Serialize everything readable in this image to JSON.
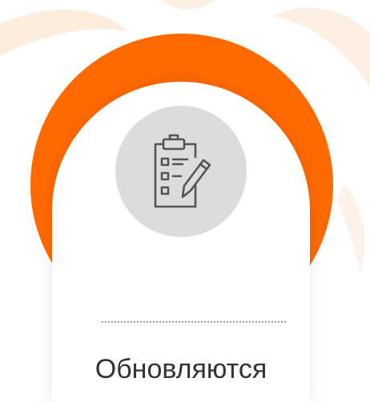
{
  "card": {
    "caption": "Обновляются",
    "icon": "clipboard-checklist-pencil-icon"
  },
  "colors": {
    "accent": "#ff6a00",
    "icon_bg": "#dcdcdc",
    "icon_stroke": "#555555",
    "text": "#333333",
    "card_bg": "#ffffff"
  }
}
